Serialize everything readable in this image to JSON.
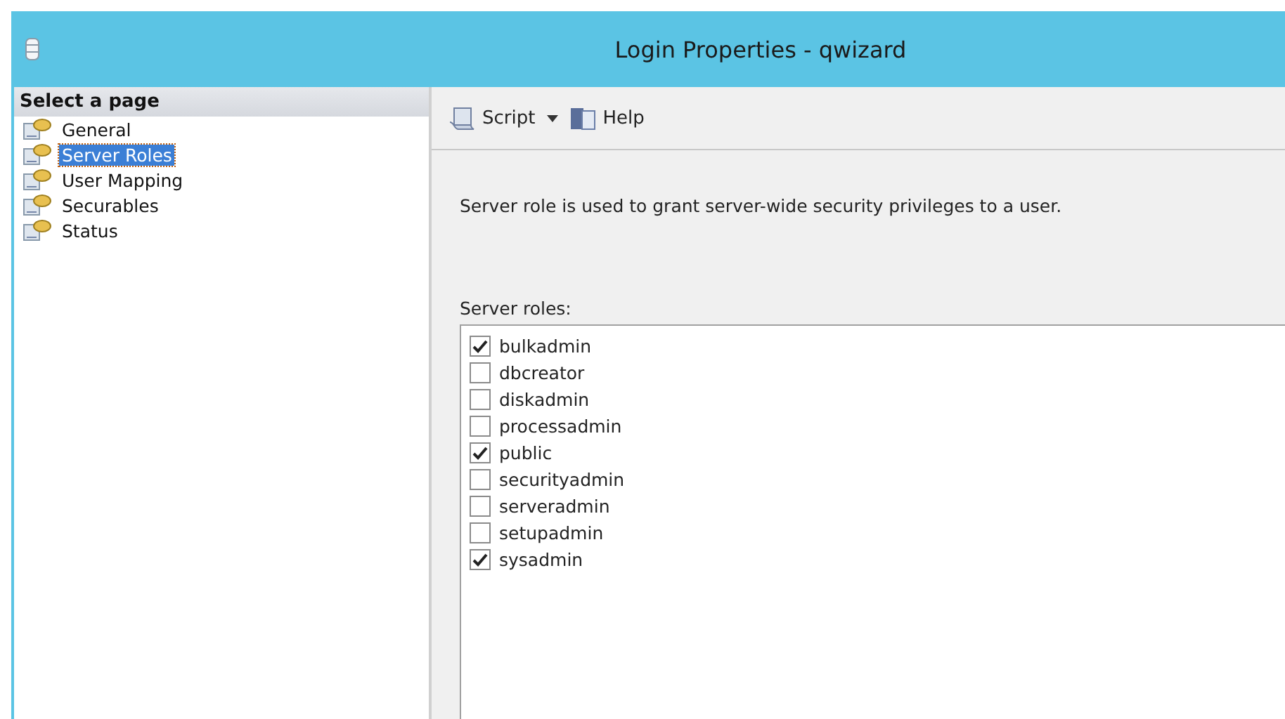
{
  "window": {
    "title": "Login Properties - qwizard"
  },
  "sidebar": {
    "header": "Select a page",
    "items": [
      {
        "label": "General",
        "selected": false
      },
      {
        "label": "Server Roles",
        "selected": true
      },
      {
        "label": "User Mapping",
        "selected": false
      },
      {
        "label": "Securables",
        "selected": false
      },
      {
        "label": "Status",
        "selected": false
      }
    ]
  },
  "toolbar": {
    "script": "Script",
    "help": "Help"
  },
  "description": "Server role is used to grant server-wide security privileges to a user.",
  "roles_label": "Server roles:",
  "roles": [
    {
      "label": "bulkadmin",
      "checked": true
    },
    {
      "label": "dbcreator",
      "checked": false
    },
    {
      "label": "diskadmin",
      "checked": false
    },
    {
      "label": "processadmin",
      "checked": false
    },
    {
      "label": "public",
      "checked": true
    },
    {
      "label": "securityadmin",
      "checked": false
    },
    {
      "label": "serveradmin",
      "checked": false
    },
    {
      "label": "setupadmin",
      "checked": false
    },
    {
      "label": "sysadmin",
      "checked": true
    }
  ]
}
